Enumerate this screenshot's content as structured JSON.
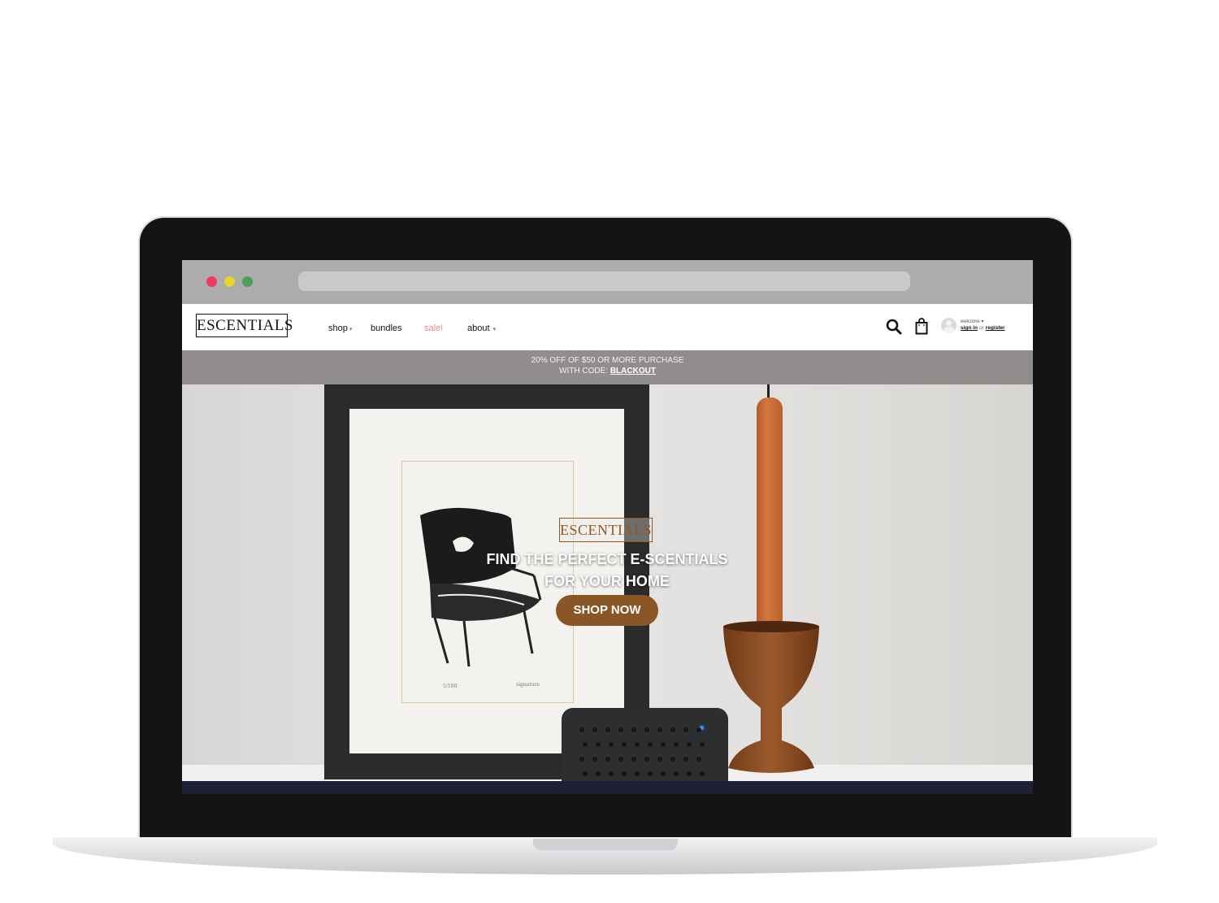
{
  "site": {
    "logo": "ESCENTIALS",
    "nav": {
      "shop": "shop",
      "bundles": "bundles",
      "sale": "sale!",
      "about": "about"
    },
    "account": {
      "welcome": "welcome",
      "sign_in": "sign in",
      "or": "or",
      "register": "register"
    },
    "colors": {
      "sale": "#e88787",
      "accent_brown": "#8a5626",
      "promo_bg": "#928d8d"
    }
  },
  "promo": {
    "line1": "20% OFF OF $50 OR MORE PURCHASE",
    "line2_prefix": "WITH CODE:",
    "code": "BLACKOUT"
  },
  "hero": {
    "logo": "ESCENTIALS",
    "headline_line1": "FIND THE PERFECT E-SCENTIALS",
    "headline_line2": "FOR YOUR HOME",
    "cta": "SHOP NOW"
  },
  "icons": {
    "search": "search-icon",
    "bag": "shopping-bag-icon",
    "avatar": "user-avatar-icon"
  }
}
